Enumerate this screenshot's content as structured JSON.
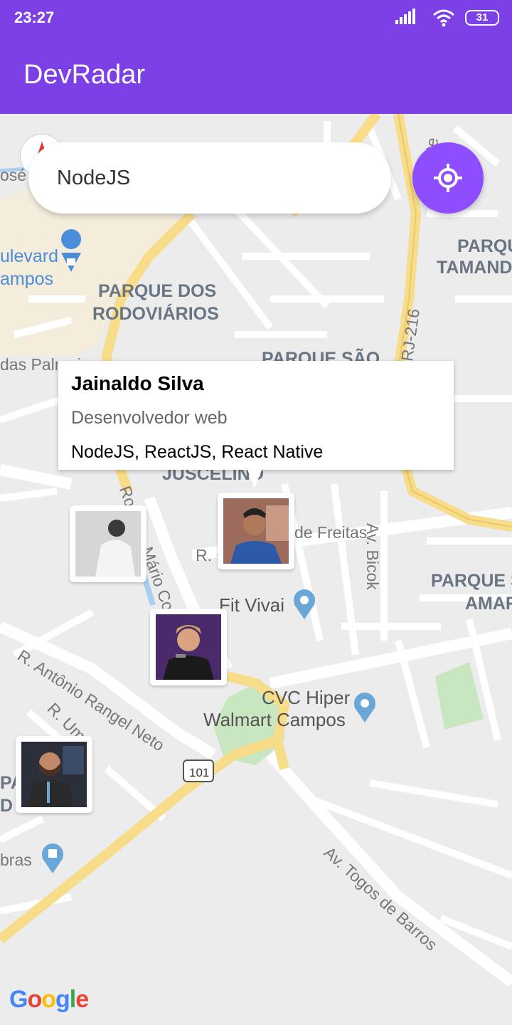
{
  "status_bar": {
    "time": "23:27",
    "battery": "31",
    "icons": [
      "signal-icon",
      "wifi-icon",
      "battery-icon"
    ]
  },
  "app_bar": {
    "title": "DevRadar",
    "color": "#7d40e7"
  },
  "search": {
    "value": "NodeJS",
    "placeholder": ""
  },
  "locate_button": {
    "icon": "my-location-icon",
    "color": "#8e4dff"
  },
  "callout": {
    "name": "Jainaldo Silva",
    "bio": "Desenvolvedor web",
    "techs": "NodeJS, ReactJS, React Native"
  },
  "map": {
    "labels": {
      "parque_dos_rodoviarios_1": "PARQUE DOS",
      "parque_dos_rodoviarios_2": "RODOVIÁRIOS",
      "parque_sao": "PARQUE SÃO",
      "juscelino": "JUSCELINO",
      "parque_tamandare_1": "PARQU",
      "parque_tamandare_2": "TAMAND",
      "parque_s_amaro_1": "PARQUE S",
      "parque_s_amaro_2": "AMAR",
      "boulevard_1": "ulevard",
      "boulevard_2": "ampos",
      "das_palmeiras": "das Palmeiras",
      "jose": "osé",
      "av_vinte": "Av. Vinte",
      "rj_216": "RJ-216",
      "de_freitas": "de Freitas",
      "r_g": "R. G",
      "av_bicok": "Av. Bicok",
      "rod_mario_covas": "Rod. Av. Mário Cova",
      "r_antonio_rangel_neto": "R. Antônio Rangel Neto",
      "r_um": "R. Um",
      "road_101": "101",
      "av_togos_de_barros": "Av. Togos de Barros",
      "pa_1": "PA",
      "pa_2": "D",
      "bras": "bras",
      "fit_vivai": "Fit Vivai",
      "cvc_hiper": "CVC Hiper",
      "walmart_campos": "Walmart Campos"
    },
    "markers": [
      {
        "name": "dev-marker-1"
      },
      {
        "name": "dev-marker-2"
      },
      {
        "name": "dev-marker-3"
      },
      {
        "name": "dev-marker-4"
      }
    ]
  },
  "google_logo": "Google"
}
